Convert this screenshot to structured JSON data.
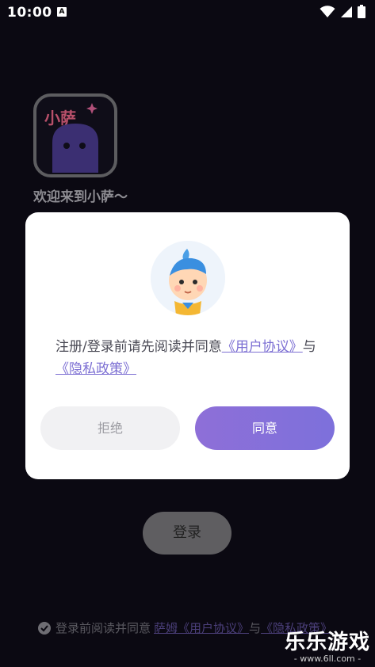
{
  "status_bar": {
    "time": "10:00",
    "sim_label": "A"
  },
  "welcome": {
    "text": "欢迎来到小萨～",
    "logo_text": "小萨"
  },
  "dialog": {
    "text_prefix": "注册/登录前请先阅读并同意",
    "user_agreement": "《用户协议》",
    "connector": "与",
    "privacy_policy": "《隐私政策》",
    "reject_label": "拒绝",
    "agree_label": "同意"
  },
  "login": {
    "label": "登录"
  },
  "bottom_agree": {
    "prefix": "登录前阅读并同意",
    "user_agreement": "萨姆《用户协议》",
    "connector": "与",
    "privacy_policy": "《隐私政策》"
  },
  "watermark": {
    "title": "乐乐游戏",
    "url": "- www.6ll.com -"
  },
  "colors": {
    "accent": "#7c6fd3",
    "background": "#0b0912"
  }
}
